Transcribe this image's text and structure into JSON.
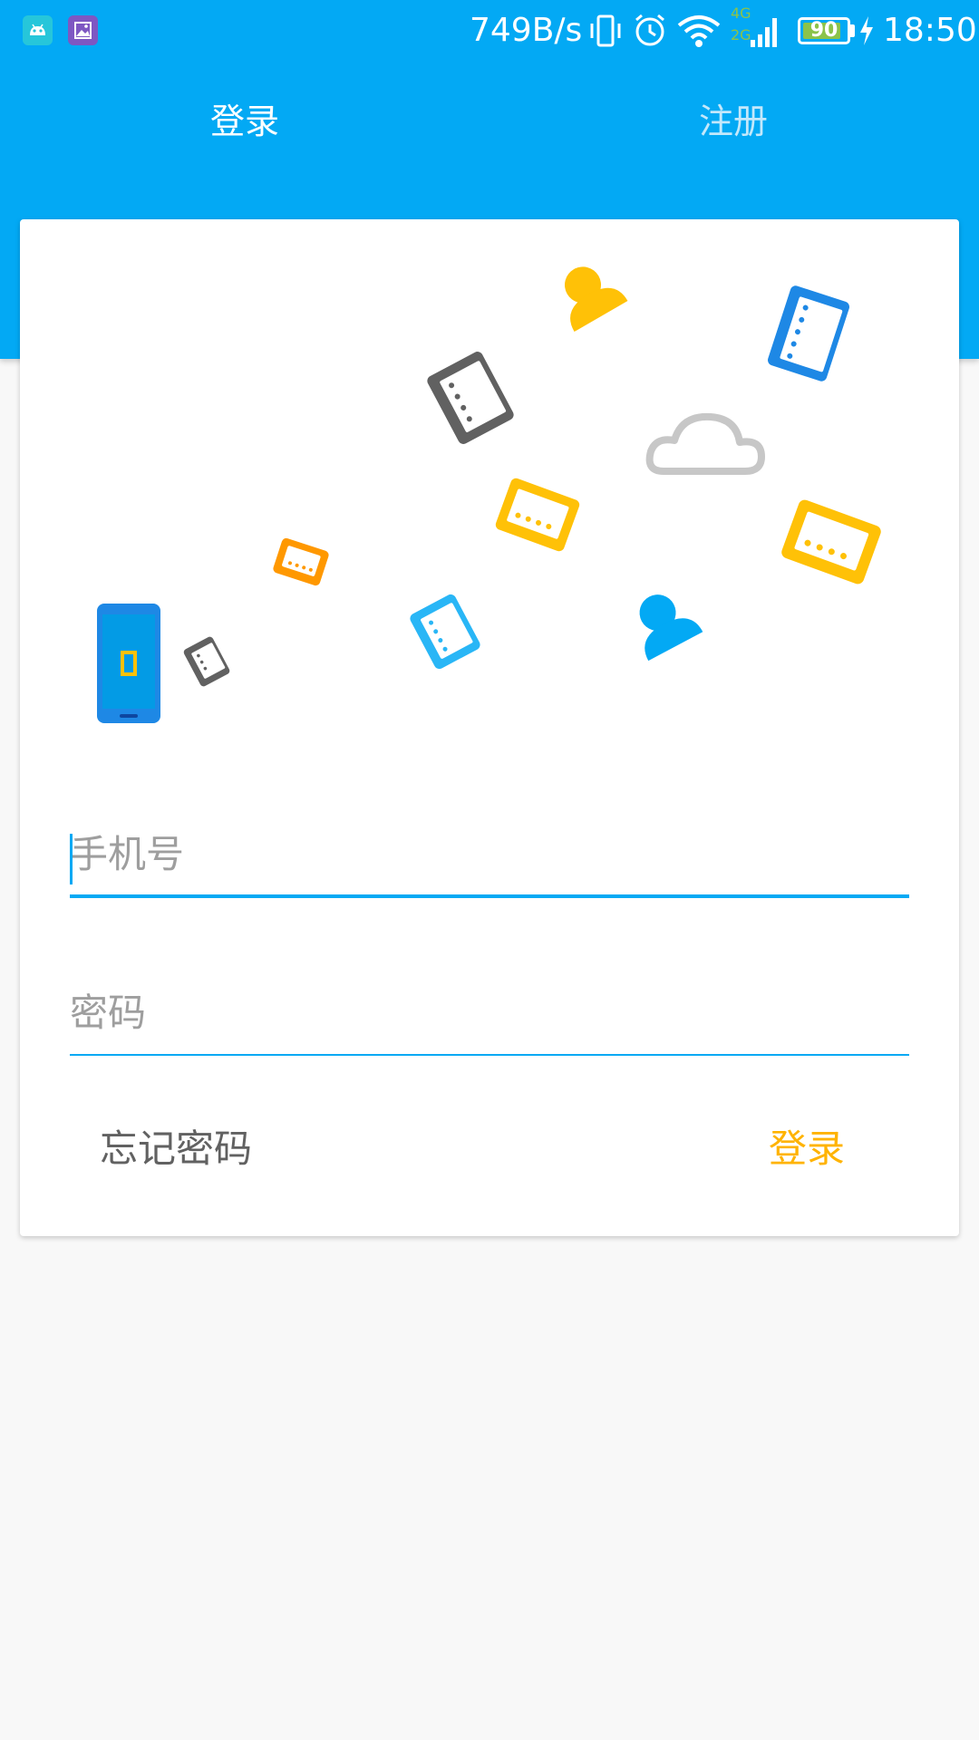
{
  "status_bar": {
    "net_speed": "749B/s",
    "network_labels": [
      "4G",
      "2G"
    ],
    "battery_level": 90,
    "battery_text": "90",
    "time": "18:50",
    "icons": [
      "android-icon",
      "gallery-icon",
      "vibrate-icon",
      "alarm-icon",
      "wifi-icon",
      "signal-icon",
      "battery-icon",
      "charging-icon"
    ]
  },
  "tabs": {
    "login_label": "登录",
    "register_label": "注册",
    "active": "login"
  },
  "form": {
    "phone_placeholder": "手机号",
    "phone_value": "",
    "password_placeholder": "密码",
    "password_value": "",
    "forgot_label": "忘记密码",
    "submit_label": "登录"
  },
  "illustration": {
    "items": [
      "phone-icon",
      "notebook-icon",
      "tablet-icon",
      "person-icon",
      "cloud-icon"
    ]
  },
  "colors": {
    "primary": "#03a9f4",
    "accent": "#ffb300",
    "background": "#f8f8f8",
    "card": "#ffffff"
  }
}
